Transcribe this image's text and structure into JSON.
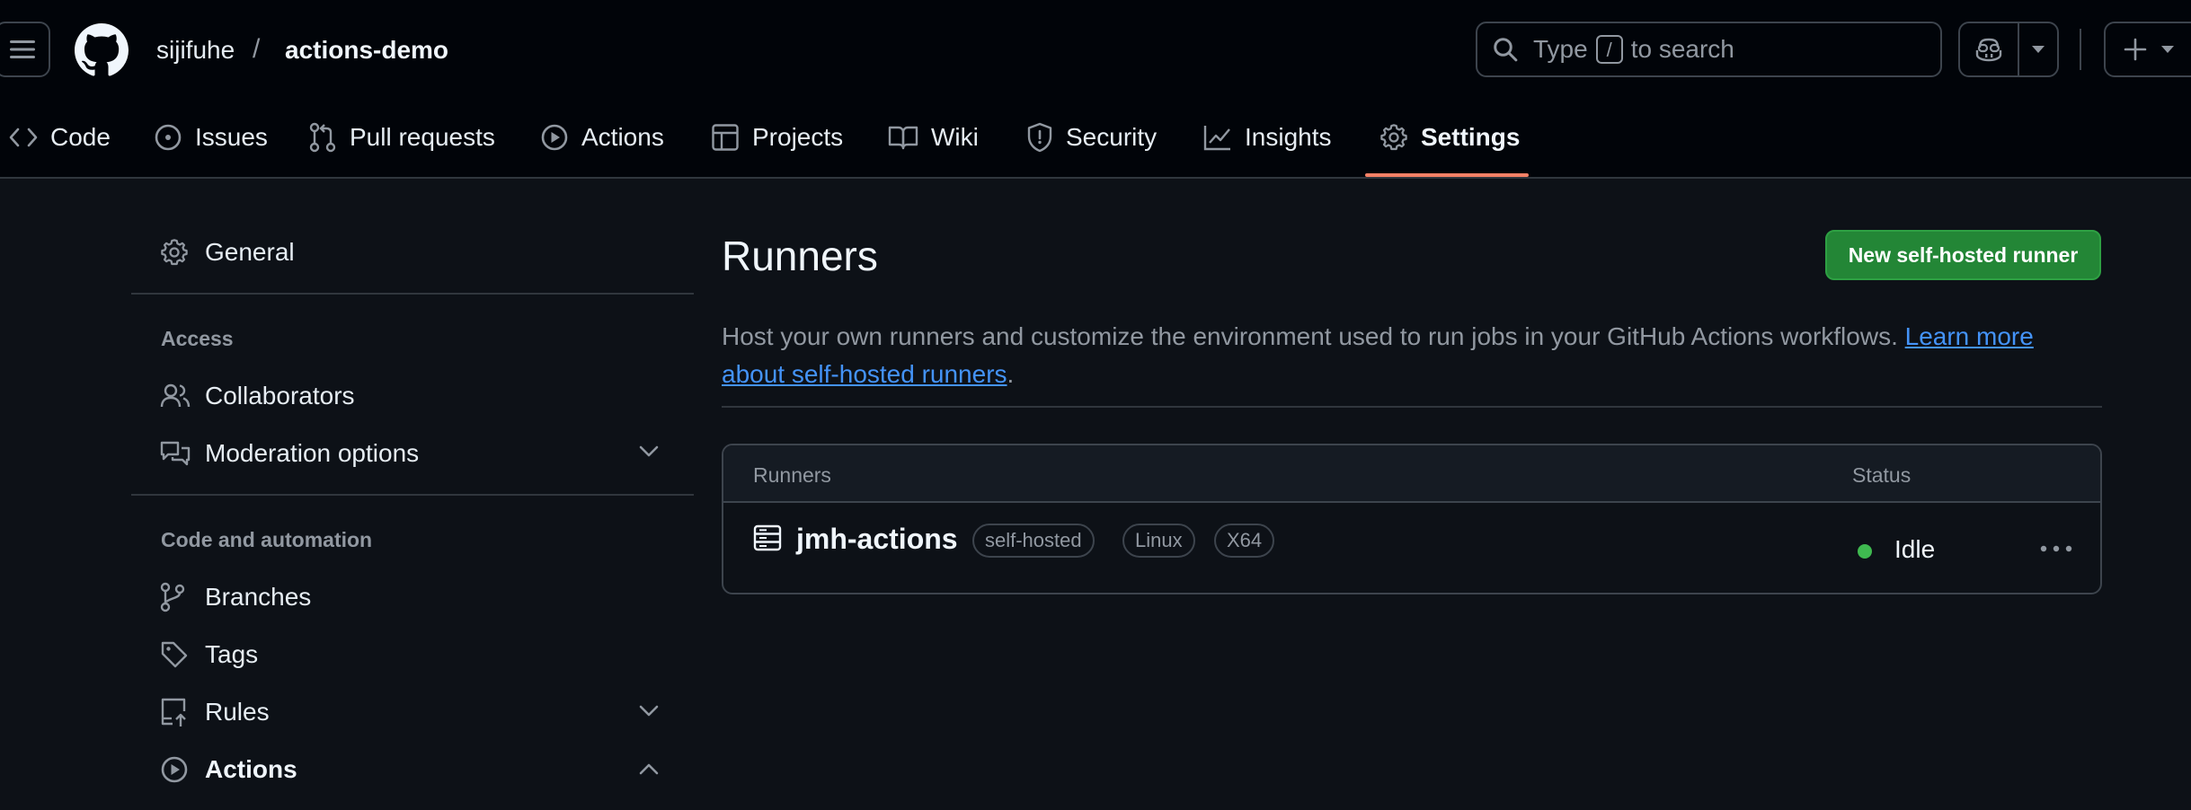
{
  "header": {
    "owner": "sijifuhe",
    "separator": "/",
    "repo": "actions-demo",
    "search": {
      "prefix": "Type",
      "key": "/",
      "suffix": "to search"
    }
  },
  "tabs": [
    {
      "label": "Code",
      "icon": "code-icon"
    },
    {
      "label": "Issues",
      "icon": "issue-icon"
    },
    {
      "label": "Pull requests",
      "icon": "pull-request-icon"
    },
    {
      "label": "Actions",
      "icon": "play-icon"
    },
    {
      "label": "Projects",
      "icon": "table-icon"
    },
    {
      "label": "Wiki",
      "icon": "book-icon"
    },
    {
      "label": "Security",
      "icon": "shield-icon"
    },
    {
      "label": "Insights",
      "icon": "graph-icon"
    },
    {
      "label": "Settings",
      "icon": "gear-icon",
      "active": true
    }
  ],
  "sidebar": {
    "general": "General",
    "access_heading": "Access",
    "collaborators": "Collaborators",
    "moderation": "Moderation options",
    "code_heading": "Code and automation",
    "branches": "Branches",
    "tags": "Tags",
    "rules": "Rules",
    "actions": "Actions"
  },
  "main": {
    "title": "Runners",
    "new_button": "New self-hosted runner",
    "description": "Host your own runners and customize the environment used to run jobs in your GitHub Actions workflows.",
    "learn_more": "Learn more about self-hosted runners",
    "period": "."
  },
  "runners_table": {
    "col_runners": "Runners",
    "col_status": "Status",
    "rows": [
      {
        "name": "jmh-actions",
        "labels": [
          "self-hosted",
          "Linux",
          "X64"
        ],
        "status": "Idle"
      }
    ]
  },
  "colors": {
    "accent_tab": "#f78166",
    "button_green": "#238636",
    "status_idle": "#3fb950",
    "link": "#4493f8"
  }
}
